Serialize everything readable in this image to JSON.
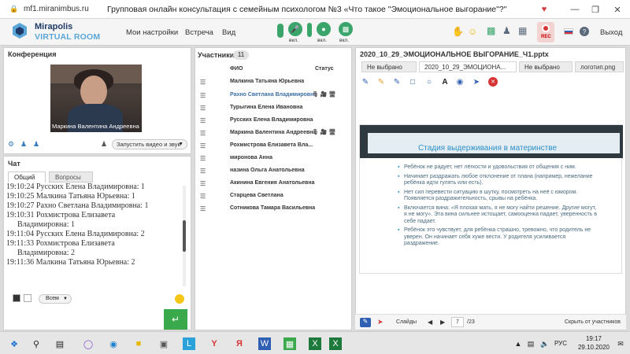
{
  "browser": {
    "url": "mf1.miranimbus.ru",
    "title": "Групповая онлайн консультация с семейным психологом №3 «Что такое \"Эмоциональное выгорание\"?\""
  },
  "app": {
    "logo_line1": "Mirapolis",
    "logo_line2": "VIRTUAL ROOM",
    "menu": [
      "Мои настройки",
      "Встреча",
      "Вид"
    ],
    "media_labels": [
      "вкл.",
      "вкл.",
      "вкл."
    ],
    "rec_label": "REC",
    "exit_label": "Выход",
    "colors": {
      "accent_green": "#3aa56b",
      "rec_red": "#d73535",
      "brand_blue": "#5aa6d8"
    }
  },
  "conference": {
    "title": "Конференция",
    "video_name": "Маркина Валентина  Андреевна",
    "start_video_label": "Запустить видео и звук"
  },
  "chat": {
    "title": "Чат",
    "tabs": [
      "Общий",
      "Вопросы"
    ],
    "messages": [
      "19:10:24 Русских Елена Владимировна: 1",
      "19:10:25 Малкина Татьяна  Юрьевна: 1",
      "19:10:27 Рахно Светлана  Владимировна: 1",
      "19:10:31 Рохмистрова  Елизавета",
      "Владимировна: 1",
      "19:11:04 Русских Елена Владимировна: 2",
      "19:11:33 Рохмистрова  Елизавета",
      "Владимировна: 2",
      "19:11:36 Малкина Татьяна  Юрьевна: 2"
    ],
    "recipient": "Всем"
  },
  "participants": {
    "title": "Участники",
    "count": "11",
    "col_name": "ФИО",
    "col_status": "Статус",
    "rows": [
      {
        "name": "Малкина Татьяна  Юрьевна",
        "active": false,
        "status": ""
      },
      {
        "name": "Рахно Светлана  Владимировна",
        "active": true,
        "status": "🎙 🎥 🖥"
      },
      {
        "name": "Турыгина  Елена  Ивановна",
        "active": false,
        "status": ""
      },
      {
        "name": "Русских Елена Владимировна",
        "active": false,
        "status": ""
      },
      {
        "name": "Маркина Валентина  Андреевна",
        "active": false,
        "status": "🎙 🎥 🖥"
      },
      {
        "name": "Рохмистрова  Елизавета Вла...",
        "active": false,
        "status": ""
      },
      {
        "name": "миронова  Анна",
        "active": false,
        "status": ""
      },
      {
        "name": "назина  Ольга  Анатольевна",
        "active": false,
        "status": ""
      },
      {
        "name": "Акинина  Евгения Анатольевна",
        "active": false,
        "status": ""
      },
      {
        "name": "Старцева  Светлана",
        "active": false,
        "status": ""
      },
      {
        "name": "Сотникова Тамара Васильевна",
        "active": false,
        "status": ""
      }
    ]
  },
  "presentation": {
    "title": "2020_10_29_ЭМОЦИОНАЛЬНОЕ ВЫГОРАНИЕ_Ч1.pptx",
    "tabs": [
      "Не выбрано",
      "2020_10_29_ЭМОЦИОНА...",
      "Не выбрано",
      "логотип.png"
    ],
    "slide": {
      "title": "Стадия выдерживания в материнстве",
      "bullets": [
        "Ребёнок не радует, нет лёгкости и удовольствия от общения с ним.",
        "Начинает раздражать любое отклонение от плана (например, нежелание ребёнка идти гулять или есть).",
        "Нет сил перевести ситуацию в шутку, посмотреть на неё с юмором. Появляется раздражительность, срывы на ребёнка.",
        "Включается вина: «Я плохая мать, я не могу найти решение. Другие могут, я не могу». Эта вина сильнее истощает, самооценка падает, уверенность в себе падает.",
        "Ребёнок это чувствует, для ребёнка страшно, тревожно, что родитель не уверен. Он начинает себя хуже вести. У родителя усиливается раздражение."
      ]
    },
    "slides_label": "Слайды",
    "current_page": "7",
    "total_pages": "/23",
    "hide_participants": "Скрыть от участников"
  },
  "taskbar": {
    "lang": "РУС",
    "time": "19:17",
    "date": "29.10.2020"
  }
}
